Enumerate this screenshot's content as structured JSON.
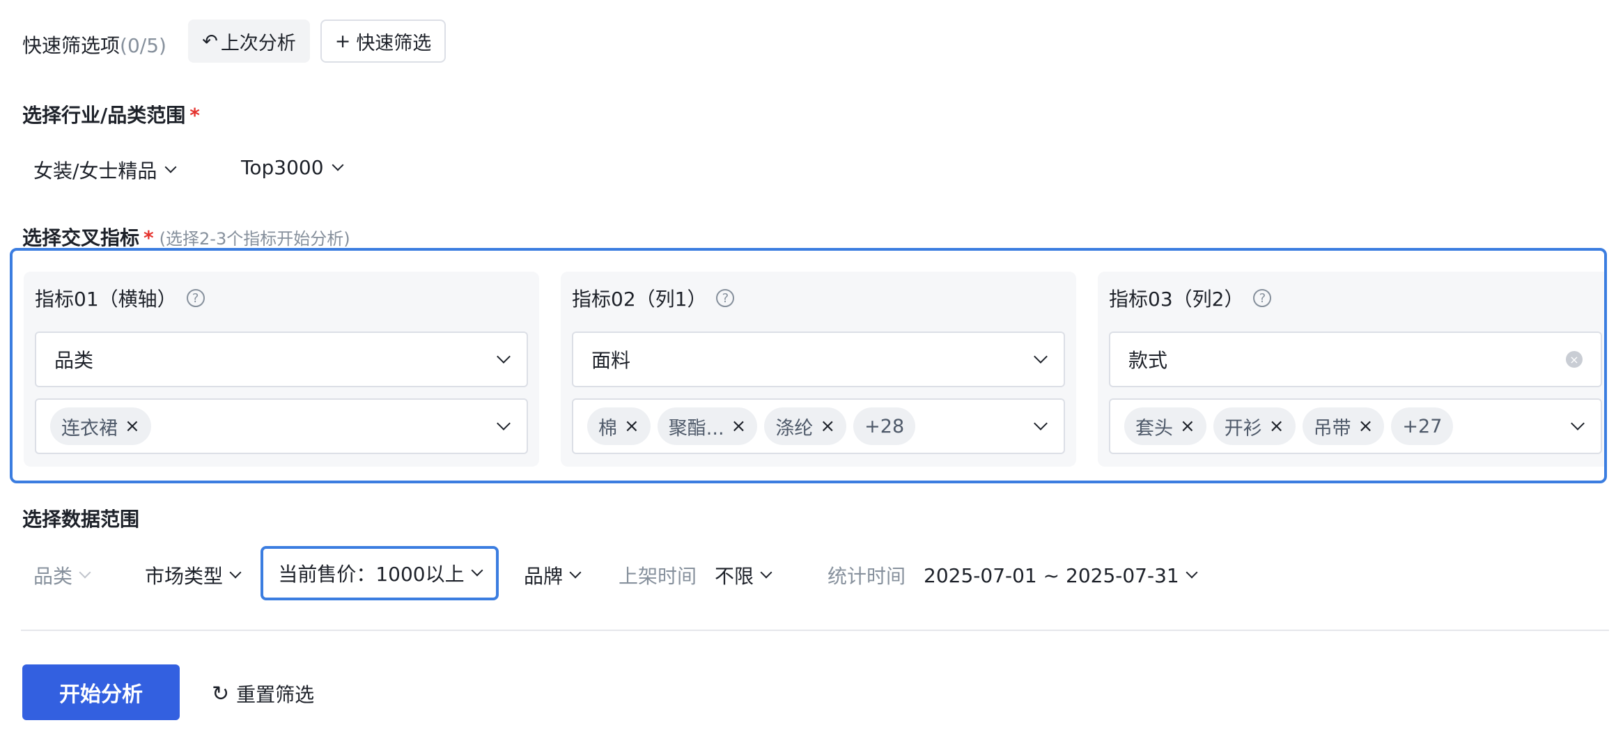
{
  "quick_filter": {
    "label": "快速筛选项",
    "count": "(0/5)",
    "last_analysis": "上次分析",
    "add_quick": "快速筛选"
  },
  "industry": {
    "title": "选择行业/品类范围",
    "required_mark": "*",
    "category": "女装/女士精品",
    "rank": "Top3000"
  },
  "cross": {
    "title": "选择交叉指标",
    "required_mark": "*",
    "hint": "(选择2-3个指标开始分析)",
    "cards": [
      {
        "title": "指标01（横轴）",
        "field": "品类",
        "tags": [
          "连衣裙"
        ],
        "more": ""
      },
      {
        "title": "指标02（列1）",
        "field": "面料",
        "tags": [
          "棉",
          "聚酯...",
          "涤纶"
        ],
        "more": "+28"
      },
      {
        "title": "指标03（列2）",
        "field": "款式",
        "tags": [
          "套头",
          "开衫",
          "吊带"
        ],
        "more": "+27"
      }
    ]
  },
  "data_range": {
    "title": "选择数据范围",
    "category": "品类",
    "market_type": "市场类型",
    "price": "当前售价：1000以上",
    "brand": "品牌",
    "listing_time_label": "上架时间",
    "listing_time_value": "不限",
    "stat_time_label": "统计时间",
    "stat_time_value": "2025-07-01 ~ 2025-07-31"
  },
  "actions": {
    "start": "开始分析",
    "reset": "重置筛选"
  }
}
